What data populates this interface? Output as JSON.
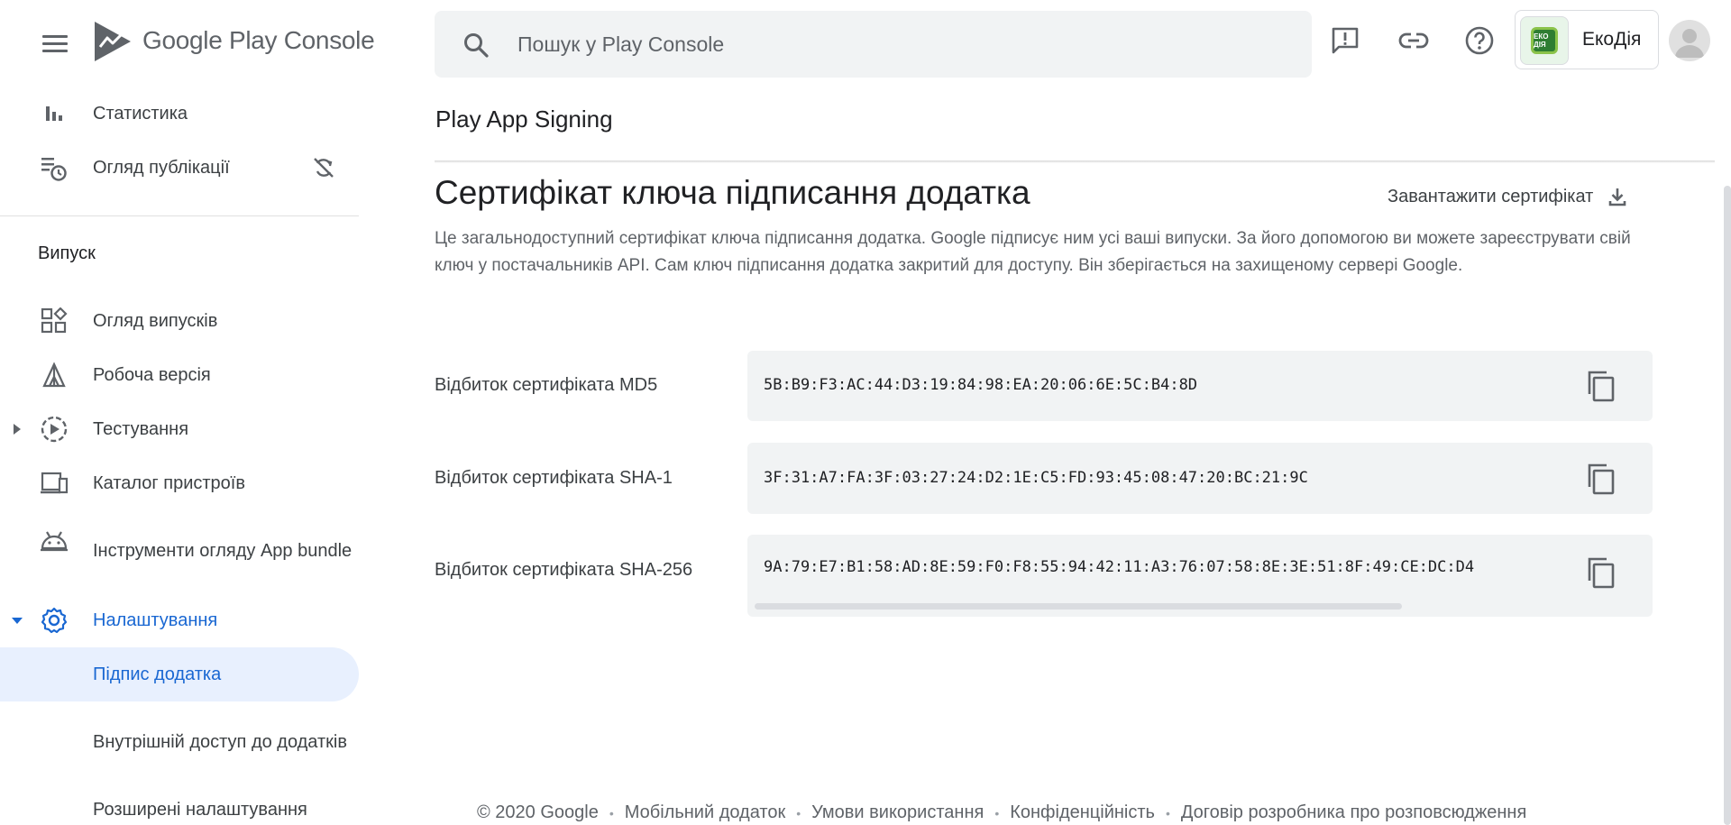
{
  "app": {
    "brand": "Google Play",
    "brand_suffix": "Console"
  },
  "search": {
    "placeholder": "Пошук у Play Console"
  },
  "account": {
    "app_name": "ЕкоДія",
    "app_icon_text": "ЕКО ДІЯ"
  },
  "sidebar": {
    "top_items": [
      {
        "label": "Статистика",
        "icon": "bar-chart-icon"
      },
      {
        "label": "Огляд публікації",
        "icon": "publishing-overview-icon"
      }
    ],
    "section_title": "Випуск",
    "items": [
      {
        "label": "Огляд випусків",
        "icon": "dashboard-icon"
      },
      {
        "label": "Робоча версія",
        "icon": "production-icon"
      },
      {
        "label": "Тестування",
        "icon": "testing-icon"
      },
      {
        "label": "Каталог пристроїв",
        "icon": "devices-icon"
      },
      {
        "label": "Інструменти огляду App bundle",
        "icon": "android-icon"
      },
      {
        "label": "Налаштування",
        "icon": "gear-icon"
      },
      {
        "label": "Підпис додатка"
      },
      {
        "label": "Внутрішній доступ до додатків"
      },
      {
        "label": "Розширені налаштування"
      }
    ]
  },
  "page": {
    "title": "Play App Signing",
    "card_title": "Сертифікат ключа підписання додатка",
    "download_label": "Завантажити сертифікат",
    "description": "Це загальнодоступний сертифікат ключа підписання додатка. Google підписує ним усі ваші випуски. За його допомогою ви можете зареєструвати свій ключ у постачальників API. Сам ключ підписання додатка закритий для доступу. Він зберігається на захищеному сервері Google."
  },
  "fingerprints": [
    {
      "label": "Відбиток сертифіката MD5",
      "value": "5B:B9:F3:AC:44:D3:19:84:98:EA:20:06:6E:5C:B4:8D"
    },
    {
      "label": "Відбиток сертифіката SHA-1",
      "value": "3F:31:A7:FA:3F:03:27:24:D2:1E:C5:FD:93:45:08:47:20:BC:21:9C"
    },
    {
      "label": "Відбиток сертифіката SHA-256",
      "value": "9A:79:E7:B1:58:AD:8E:59:F0:F8:55:94:42:11:A3:76:07:58:8E:3E:51:8F:49:CE:DC:D4"
    }
  ],
  "footer": {
    "copyright": "© 2020 Google",
    "links": [
      "Мобільний додаток",
      "Умови використання",
      "Конфіденційність",
      "Договір розробника про розповсюдження"
    ]
  },
  "colors": {
    "accent": "#1967d2",
    "active_bg": "#e8f0fe",
    "surface": "#f1f3f4"
  }
}
